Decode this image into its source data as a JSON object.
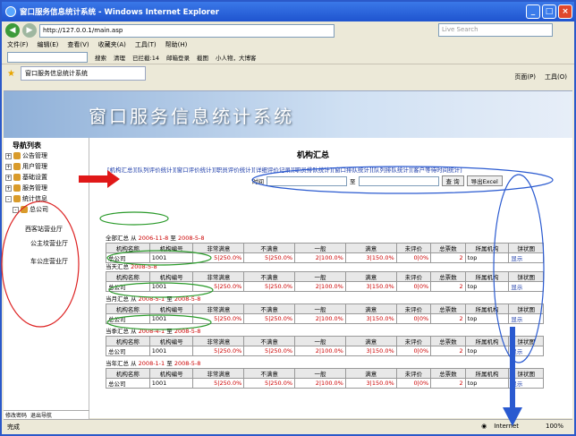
{
  "window": {
    "title": "窗口服务信息统计系统 - Windows Internet Explorer"
  },
  "address": {
    "url": "http://127.0.0.1/main.asp",
    "search_placeholder": "Live Search"
  },
  "menu": [
    "文件(F)",
    "编辑(E)",
    "查看(V)",
    "收藏夹(A)",
    "工具(T)",
    "帮助(H)"
  ],
  "toolbar": {
    "items": [
      "搜索",
      "清理",
      "已拦截:14",
      "邮箱登录",
      "截图",
      "小人物，大博客"
    ]
  },
  "tab": {
    "label": "窗口服务信息统计系统"
  },
  "tab_tools": [
    "页面(P)",
    "工具(O)"
  ],
  "banner": {
    "title": "窗口服务信息统计系统"
  },
  "sidebar": {
    "title": "导航列表",
    "items": [
      "公告管理",
      "用户管理",
      "基础设置",
      "服务管理",
      "统计信息",
      "总公司",
      "西客站营业厅",
      "公主坟营业厅",
      "车公庄营业厅"
    ],
    "bottom": [
      "修改密码",
      "退出导航"
    ]
  },
  "main": {
    "title": "机构汇总",
    "links": "[机构汇总][队列评价统计][窗口评价统计][职员评价统计][详细评价记录][职员排队统计][窗口排队统计][队列排队统计][客户等待时间统计]",
    "filter": {
      "time_label": "时间",
      "to_label": "至",
      "query_button": "查 询",
      "export_button": "导出Excel"
    },
    "headers": [
      "机构名称",
      "机构编号",
      "非常满意",
      "不满意",
      "一般",
      "满意",
      "未评价",
      "总票数",
      "所属机构",
      "饼状图"
    ],
    "row": [
      "总公司",
      "1001",
      "5|250.0%",
      "5|250.0%",
      "2|100.0%",
      "3|150.0%",
      "0|0%",
      "2",
      "top",
      "显示"
    ],
    "sections": [
      {
        "label": "全部汇总 从",
        "from": "2006-11-8",
        "to_word": "至",
        "to": "2008-5-8"
      },
      {
        "label": "当天汇总",
        "from": "2008-5-8",
        "to_word": "",
        "to": ""
      },
      {
        "label": "当月汇总 从",
        "from": "2008-5-1",
        "to_word": "至",
        "to": "2008-5-8"
      },
      {
        "label": "当季汇总 从",
        "from": "2008-4-1",
        "to_word": "至",
        "to": "2008-5-8"
      },
      {
        "label": "当年汇总 从",
        "from": "2008-1-1",
        "to_word": "至",
        "to": "2008-5-8"
      }
    ]
  },
  "status": {
    "left": "完成",
    "zone": "Internet",
    "zoom": "100%"
  }
}
